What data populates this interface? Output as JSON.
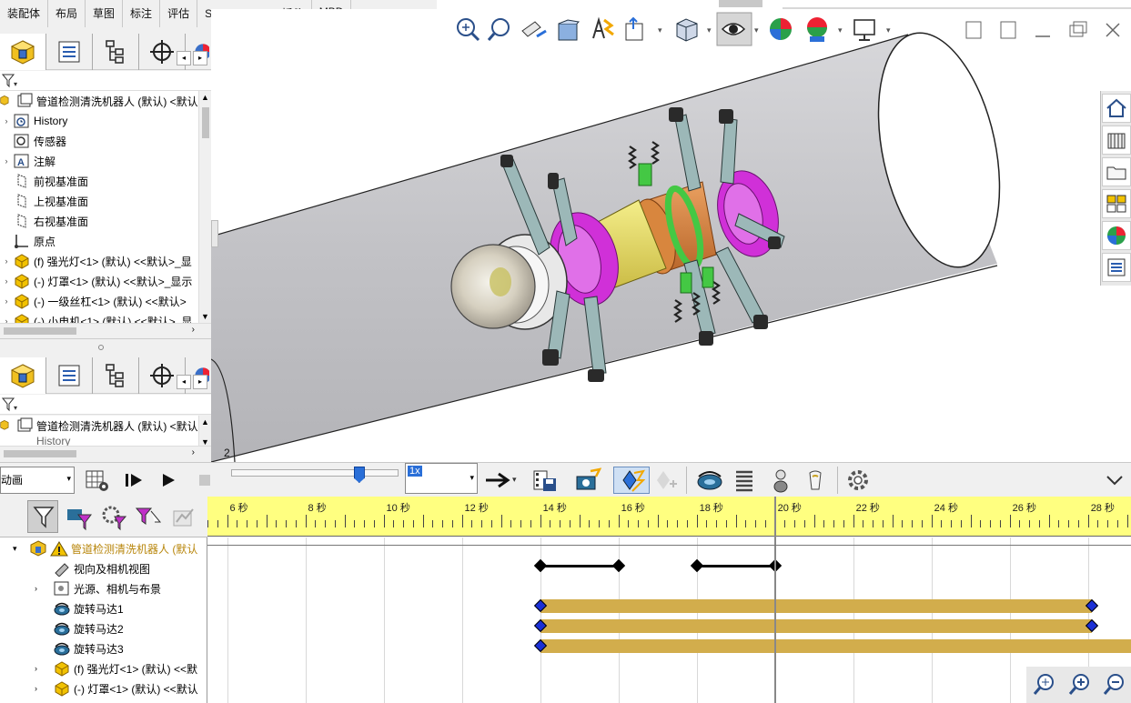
{
  "tabs": [
    "装配体",
    "布局",
    "草图",
    "标注",
    "评估",
    "SOLIDWORKS 插件",
    "MBD"
  ],
  "feature_tree": {
    "root": "管道检测清洗机器人 (默认) <默认",
    "items": [
      {
        "label": "History",
        "icon": "history-icon",
        "expandable": true
      },
      {
        "label": "传感器",
        "icon": "sensor-icon",
        "expandable": false
      },
      {
        "label": "注解",
        "icon": "annotation-icon",
        "expandable": true
      },
      {
        "label": "前视基准面",
        "icon": "plane-icon",
        "expandable": false
      },
      {
        "label": "上视基准面",
        "icon": "plane-icon",
        "expandable": false
      },
      {
        "label": "右视基准面",
        "icon": "plane-icon",
        "expandable": false
      },
      {
        "label": "原点",
        "icon": "origin-icon",
        "expandable": false
      },
      {
        "label": "(f) 强光灯<1> (默认) <<默认>_显",
        "icon": "part-icon",
        "expandable": true
      },
      {
        "label": "(-) 灯罩<1> (默认) <<默认>_显示",
        "icon": "part-icon",
        "expandable": true
      },
      {
        "label": "(-) 一级丝杠<1> (默认) <<默认>",
        "icon": "part-icon",
        "expandable": true
      },
      {
        "label": "(-) 小电机<1> (默认) <<默认>_显",
        "icon": "part-icon",
        "expandable": true
      }
    ]
  },
  "feature_tree_2": {
    "root": "管道检测清洗机器人 (默认) <默认",
    "partial": "History"
  },
  "viewport": {
    "label": "2"
  },
  "motion_toolbar": {
    "study_type": "动画",
    "playback_speed": "1x",
    "slider_fraction": 0.76
  },
  "motion_tree": {
    "root": "管道检测清洗机器人 (默认",
    "items": [
      {
        "label": "视向及相机视图",
        "icon": "camera-view-icon",
        "expandable": false
      },
      {
        "label": "光源、相机与布景",
        "icon": "lights-icon",
        "expandable": true
      },
      {
        "label": "旋转马达1",
        "icon": "rotary-motor-icon",
        "expandable": false
      },
      {
        "label": "旋转马达2",
        "icon": "rotary-motor-icon",
        "expandable": false
      },
      {
        "label": "旋转马达3",
        "icon": "rotary-motor-icon",
        "expandable": false
      },
      {
        "label": "(f) 强光灯<1> (默认) <<默",
        "icon": "part-icon",
        "expandable": true
      },
      {
        "label": "(-) 灯罩<1> (默认) <<默认",
        "icon": "part-icon",
        "expandable": true
      }
    ]
  },
  "timeline": {
    "start_sec": 5.5,
    "end_sec": 29.1,
    "labels": [
      {
        "sec": 6,
        "text": "6 秒"
      },
      {
        "sec": 8,
        "text": "8 秒"
      },
      {
        "sec": 10,
        "text": "10 秒"
      },
      {
        "sec": 12,
        "text": "12 秒"
      },
      {
        "sec": 14,
        "text": "14 秒"
      },
      {
        "sec": 16,
        "text": "16 秒"
      },
      {
        "sec": 18,
        "text": "18 秒"
      },
      {
        "sec": 20,
        "text": "20 秒"
      },
      {
        "sec": 22,
        "text": "22 秒"
      },
      {
        "sec": 24,
        "text": "24 秒"
      },
      {
        "sec": 26,
        "text": "26 秒"
      },
      {
        "sec": 28,
        "text": "28 秒"
      }
    ],
    "current_sec": 20.0,
    "camera_segments": [
      [
        14,
        16
      ],
      [
        18,
        20
      ]
    ],
    "motor_tracks": [
      {
        "start": 14,
        "end": 28.1,
        "end_key": true
      },
      {
        "start": 14,
        "end": 28.1,
        "end_key": true
      },
      {
        "start": 14,
        "end": 29.1,
        "end_key": false
      }
    ]
  },
  "colors": {
    "ruler": "#ffff80",
    "track": "#d2ad4c",
    "keyframe": "#1a2fd6",
    "pipe": "#c8c8cc",
    "magenta": "#d030d8",
    "yellow": "#e9e060",
    "orange": "#e0904a",
    "green": "#44c844"
  }
}
